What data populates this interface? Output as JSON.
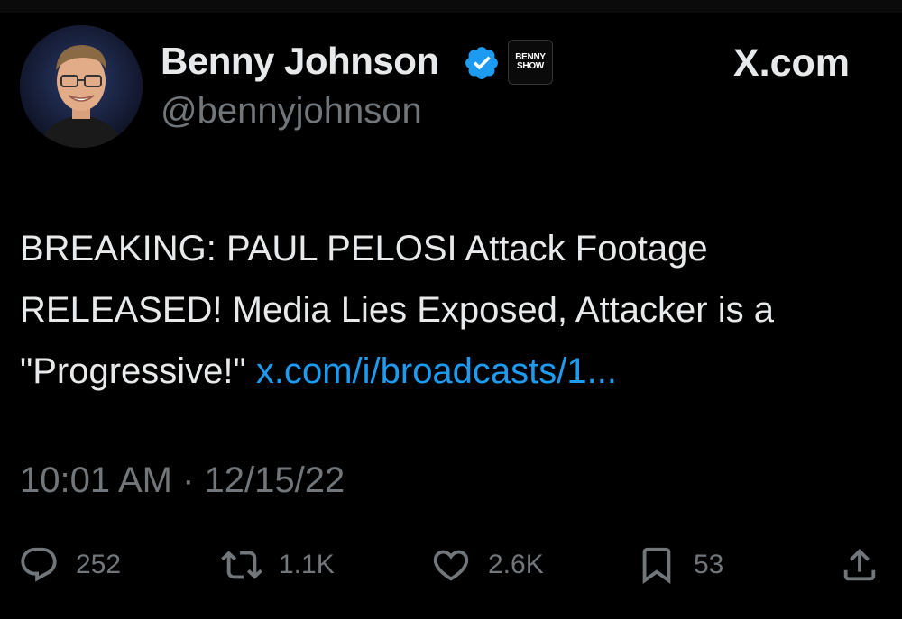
{
  "author": {
    "display_name": "Benny Johnson",
    "handle": "@bennyjohnson",
    "verified_icon": "verified-badge-icon",
    "affiliate_badge_lines": [
      "BENNY",
      "SHOW"
    ]
  },
  "site_mark": "X.com",
  "tweet": {
    "text": "BREAKING: PAUL PELOSI Attack Footage RELEASED! Media Lies Exposed, Attacker is a \"Progressive!\"",
    "link": "x.com/i/broadcasts/1...",
    "timestamp": "10:01 AM · 12/15/22"
  },
  "actions": {
    "replies": "252",
    "reposts": "1.1K",
    "likes": "2.6K",
    "bookmarks": "53"
  },
  "colors": {
    "background": "#000000",
    "text": "#e7e9ea",
    "muted": "#71767b",
    "link": "#1d9bf0",
    "verified": "#1d9bf0"
  }
}
